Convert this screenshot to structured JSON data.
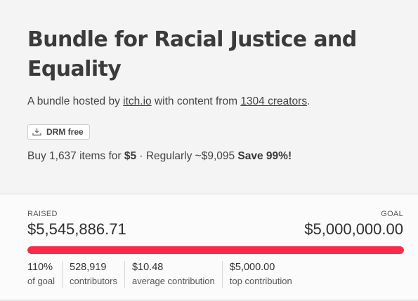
{
  "bundle": {
    "title": "Bundle for Racial Justice and Equality",
    "hosted_prefix": "A bundle hosted by ",
    "host_link": "itch.io",
    "hosted_middle": " with content from ",
    "creators_link": "1304 creators",
    "hosted_suffix": ".",
    "drm_label": "DRM free",
    "drm_icon": "download-icon",
    "buy_prefix": "Buy 1,637 items for ",
    "price": "$5",
    "buy_middle": " · Regularly ~$9,095 ",
    "save": "Save 99%!"
  },
  "progress": {
    "raised_label": "RAISED",
    "raised_amount": "$5,545,886.71",
    "goal_label": "GOAL",
    "goal_amount": "$5,000,000.00",
    "fill_fraction": 1.0,
    "bar_color": "#fa2a4b"
  },
  "metrics": [
    {
      "value": "110%",
      "label": "of goal"
    },
    {
      "value": "528,919",
      "label": "contributors"
    },
    {
      "value": "$10.48",
      "label": "average contribution"
    },
    {
      "value": "$5,000.00",
      "label": "top contribution"
    }
  ]
}
